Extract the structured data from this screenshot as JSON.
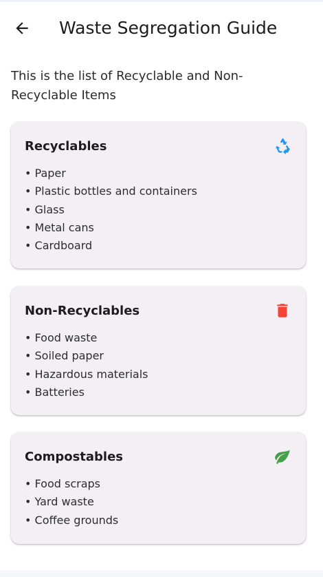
{
  "appbar": {
    "back_icon": "arrow-back-icon",
    "title": "Waste Segregation Guide"
  },
  "intro": "This is the list of Recyclable and Non-Recyclable Items",
  "cards": [
    {
      "title": "Recyclables",
      "icon": "recycle-icon",
      "icon_color": "#2196f3",
      "items": [
        "• Paper",
        "• Plastic bottles and containers",
        "• Glass",
        "• Metal cans",
        "• Cardboard"
      ]
    },
    {
      "title": "Non-Recyclables",
      "icon": "trash-icon",
      "icon_color": "#f44336",
      "items": [
        "• Food waste",
        "• Soiled paper",
        "• Hazardous materials",
        "• Batteries"
      ]
    },
    {
      "title": "Compostables",
      "icon": "leaf-icon",
      "icon_color": "#4caf50",
      "items": [
        "• Food scraps",
        "• Yard waste",
        "• Coffee grounds"
      ]
    }
  ]
}
